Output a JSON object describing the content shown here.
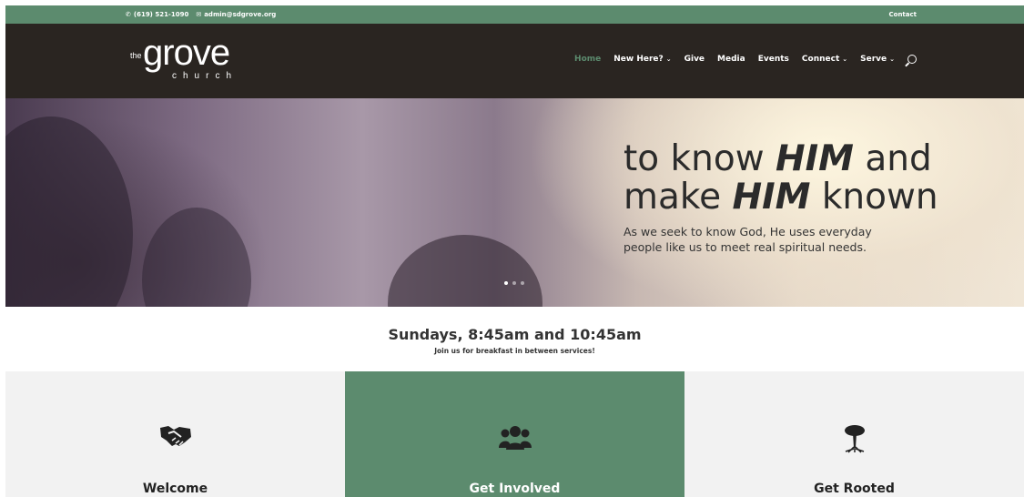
{
  "topbar": {
    "phone": "(619) 521-1090",
    "email": "admin@sdgrove.org",
    "contact": "Contact",
    "phone_icon": "phone-icon",
    "email_icon": "envelope-icon"
  },
  "logo": {
    "the": "the",
    "grove": "grove",
    "church": "church"
  },
  "nav": {
    "items": [
      {
        "label": "Home",
        "active": true,
        "dropdown": false
      },
      {
        "label": "New Here?",
        "active": false,
        "dropdown": true
      },
      {
        "label": "Give",
        "active": false,
        "dropdown": false
      },
      {
        "label": "Media",
        "active": false,
        "dropdown": false
      },
      {
        "label": "Events",
        "active": false,
        "dropdown": false
      },
      {
        "label": "Connect",
        "active": false,
        "dropdown": true
      },
      {
        "label": "Serve",
        "active": false,
        "dropdown": true
      }
    ],
    "chevron": "⌄",
    "search_icon": "search-icon"
  },
  "hero": {
    "line1_pre": "to know ",
    "line1_em": "HIM",
    "line1_post": " and",
    "line2_pre": "make ",
    "line2_em": "HIM",
    "line2_post": " known",
    "sub1": "As we seek to know God, He uses everyday",
    "sub2": "people like us to meet real spiritual needs.",
    "slide_count": 3,
    "active_slide": 1
  },
  "services": {
    "title": "Sundays, 8:45am and 10:45am",
    "subtitle": "Join us for breakfast in between services!"
  },
  "cards": [
    {
      "title": "Welcome",
      "icon": "handshake-icon"
    },
    {
      "title": "Get Involved",
      "icon": "group-icon"
    },
    {
      "title": "Get Rooted",
      "icon": "tree-icon"
    }
  ],
  "colors": {
    "accent": "#5c8b6e",
    "header": "#2a2521",
    "card": "#f2f2f2"
  }
}
